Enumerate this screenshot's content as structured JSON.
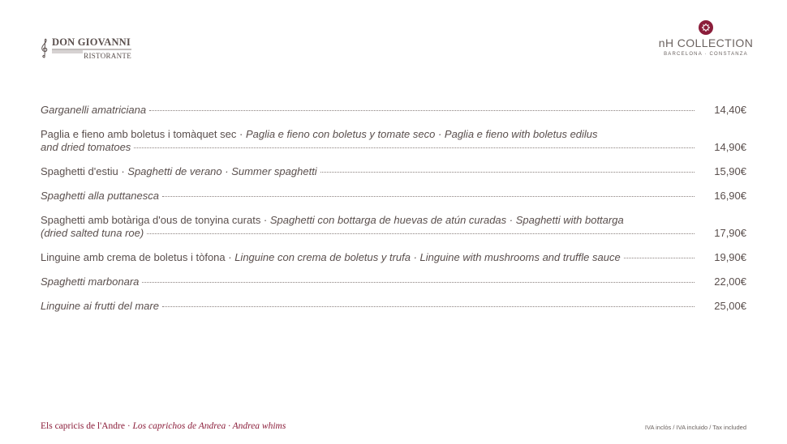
{
  "header": {
    "restaurant_name": "DON GIOVANNI",
    "restaurant_sub": "RISTORANTE",
    "hotel_line": "nH COLLECTION",
    "hotel_sub": "BARCELONA · CONSTANZA"
  },
  "menu": [
    {
      "plain": "",
      "italic": "Garganelli amatriciana",
      "price": "14,40€"
    },
    {
      "plain": "Paglia e fieno amb boletus i tomàquet sec · ",
      "italic": "Paglia e fieno con boletus y tomate seco · Paglia e fieno with boletus edilus",
      "line2": "and dried tomatoes",
      "price": "14,90€"
    },
    {
      "plain": "Spaghetti d'estiu · ",
      "italic": "Spaghetti de verano · Summer spaghetti",
      "price": "15,90€"
    },
    {
      "plain": "",
      "italic": "Spaghetti alla puttanesca",
      "price": "16,90€"
    },
    {
      "plain": "Spaghetti amb botàriga d'ous de tonyina curats · ",
      "italic": "Spaghetti con bottarga de huevas de atún curadas · Spaghetti with bottarga",
      "line2": "(dried salted tuna roe)",
      "price": "17,90€"
    },
    {
      "plain": "Linguine amb crema de boletus i tòfona · ",
      "italic": "Linguine con crema de boletus y trufa · Linguine with mushrooms and truffle sauce",
      "price": "19,90€"
    },
    {
      "plain": "",
      "italic": "Spaghetti marbonara",
      "price": "22,00€"
    },
    {
      "plain": "",
      "italic": "Linguine ai frutti del mare",
      "price": "25,00€"
    }
  ],
  "footer": {
    "plain": "Els capricis de l'Andre · ",
    "italic": "Los caprichos de Andrea · Andrea whims",
    "tax_note": "IVA inclòs / IVA incluido / Tax included"
  },
  "colors": {
    "accent": "#8b1d3a",
    "text": "#5a4f4d"
  }
}
